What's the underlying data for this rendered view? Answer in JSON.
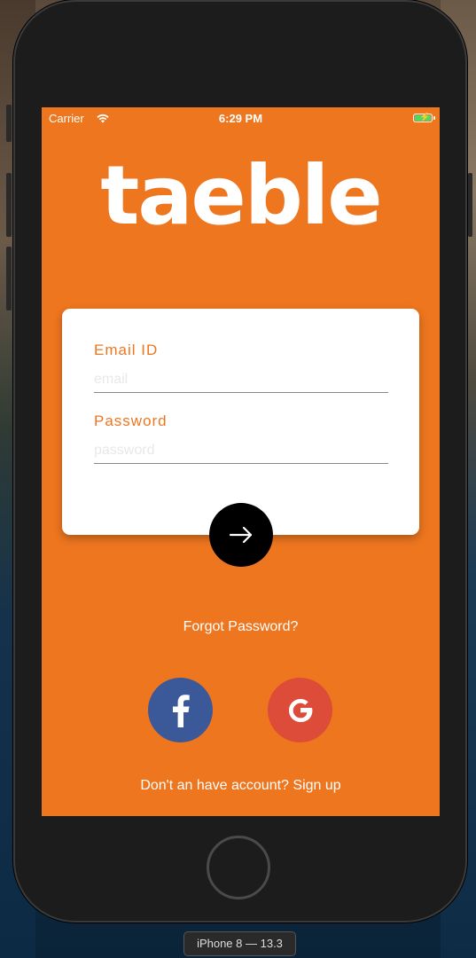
{
  "status_bar": {
    "carrier": "Carrier",
    "time": "6:29 PM"
  },
  "app": {
    "logo_text": "taeble",
    "brand_color": "#ee761f"
  },
  "login_card": {
    "email_label": "Email ID",
    "email_placeholder": "email",
    "email_value": "",
    "password_label": "Password",
    "password_placeholder": "password",
    "password_value": ""
  },
  "submit_icon": "arrow-right-icon",
  "forgot_password": "Forgot Password?",
  "social": {
    "facebook_icon": "facebook-icon",
    "facebook_color": "#3b5998",
    "google_icon": "google-icon",
    "google_color": "#dd4b39"
  },
  "signup_text": "Don't an have account? Sign up",
  "simulator": {
    "device_label": "iPhone 8 — 13.3"
  }
}
